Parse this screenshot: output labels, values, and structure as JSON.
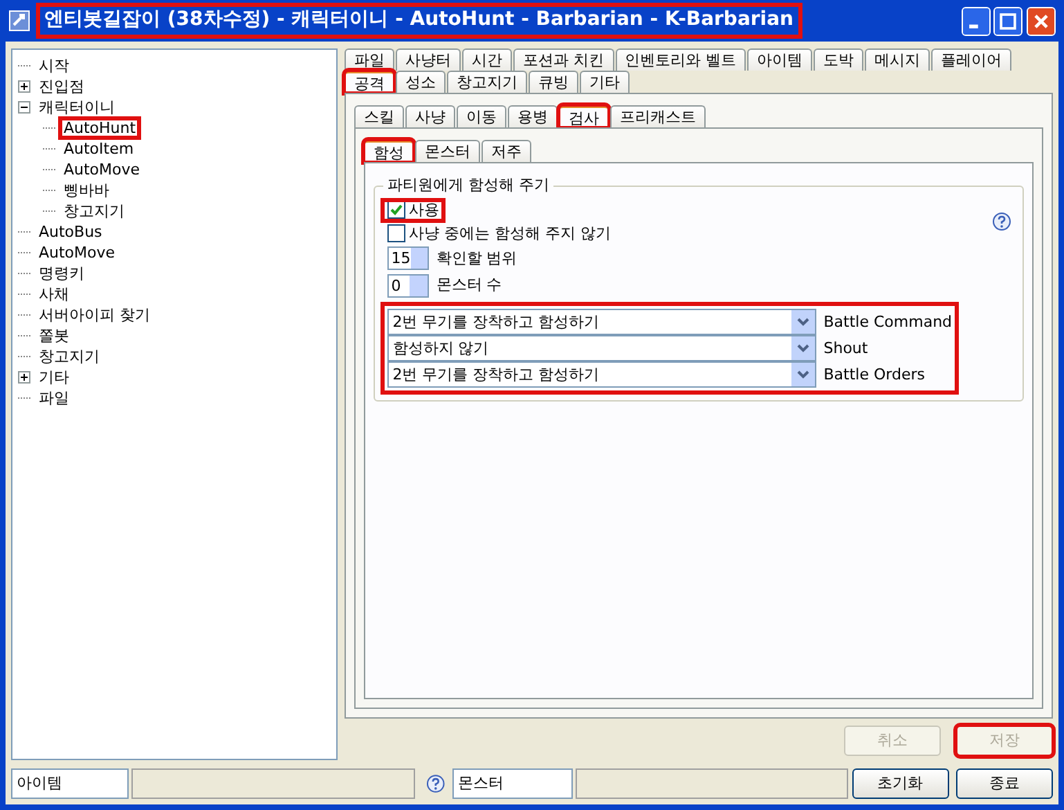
{
  "window": {
    "title": "엔티봇길잡이 (38차수정) - 캐릭터이니 - AutoHunt - Barbarian - K-Barbarian",
    "highlighted": true
  },
  "tree": [
    {
      "label": "시작"
    },
    {
      "label": "진입점",
      "expanded": false
    },
    {
      "label": "캐릭터이니",
      "expanded": true,
      "children": [
        {
          "label": "AutoHunt",
          "highlighted": true
        },
        {
          "label": "AutoItem"
        },
        {
          "label": "AutoMove"
        },
        {
          "label": "삥바바"
        },
        {
          "label": "창고지기"
        }
      ]
    },
    {
      "label": "AutoBus"
    },
    {
      "label": "AutoMove"
    },
    {
      "label": "명령키"
    },
    {
      "label": "사채"
    },
    {
      "label": "서버아이피 찾기"
    },
    {
      "label": "쫄봇"
    },
    {
      "label": "창고지기"
    },
    {
      "label": "기타",
      "expanded": false
    },
    {
      "label": "파일"
    }
  ],
  "main_tabs": [
    [
      {
        "label": "파일",
        "selected": false
      },
      {
        "label": "사냥터",
        "selected": false
      },
      {
        "label": "시간",
        "selected": false
      },
      {
        "label": "포션과 치킨",
        "selected": false
      },
      {
        "label": "인벤토리와 벨트",
        "selected": false
      },
      {
        "label": "아이템",
        "selected": false
      },
      {
        "label": "도박",
        "selected": false
      },
      {
        "label": "메시지",
        "selected": false
      },
      {
        "label": "플레이어",
        "selected": false
      }
    ],
    [
      {
        "label": "공격",
        "selected": true,
        "highlighted": true
      },
      {
        "label": "성소",
        "selected": false
      },
      {
        "label": "창고지기",
        "selected": false
      },
      {
        "label": "큐빙",
        "selected": false
      },
      {
        "label": "기타",
        "selected": false
      }
    ]
  ],
  "sub_tabs": [
    {
      "label": "스킬",
      "selected": false
    },
    {
      "label": "사냥",
      "selected": false
    },
    {
      "label": "이동",
      "selected": false
    },
    {
      "label": "용병",
      "selected": false
    },
    {
      "label": "검사",
      "selected": true,
      "highlighted": true
    },
    {
      "label": "프리캐스트",
      "selected": false
    }
  ],
  "inner_tabs": [
    {
      "label": "함성",
      "selected": true,
      "highlighted": true
    },
    {
      "label": "몬스터",
      "selected": false
    },
    {
      "label": "저주",
      "selected": false
    }
  ],
  "group": {
    "title": "파티원에게 함성해 주기",
    "checkboxes": [
      {
        "label": "사용",
        "checked": true,
        "highlighted": true
      },
      {
        "label": "사냥 중에는 함성해 주지 않기",
        "checked": false
      }
    ],
    "spinners": [
      {
        "value": "15",
        "label": "확인할 범위"
      },
      {
        "value": "0",
        "label": "몬스터 수"
      }
    ],
    "skills_highlighted": true,
    "skills": [
      {
        "value": "2번 무기를 장착하고 함성하기",
        "label": "Battle Command"
      },
      {
        "value": "함성하지 않기",
        "label": "Shout"
      },
      {
        "value": "2번 무기를 장착하고 함성하기",
        "label": "Battle Orders"
      }
    ]
  },
  "buttons": [
    {
      "label": "취소",
      "disabled": true
    },
    {
      "label": "저장",
      "disabled": true,
      "highlighted": true
    }
  ],
  "status_bar": {
    "item_field": "아이템",
    "monster_field": "몬스터",
    "buttons": [
      {
        "label": "초기화",
        "disabled": false
      },
      {
        "label": "종료",
        "disabled": false
      }
    ]
  }
}
